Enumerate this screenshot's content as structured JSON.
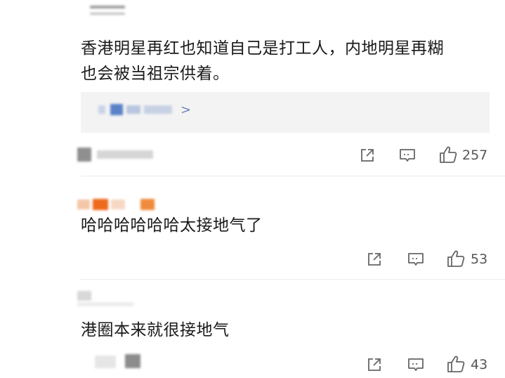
{
  "comments": [
    {
      "text_line1": "香港明星再红也知道自己是打工人，内地明星再糊",
      "text_line2": "也会被当祖宗供着。",
      "likes": "257"
    },
    {
      "text_line1": "哈哈哈哈哈哈太接地气了",
      "likes": "53"
    },
    {
      "text_line1": "港圈本来就很接地气",
      "likes": "43"
    }
  ],
  "quote": {
    "chevron": ">"
  },
  "icons": {
    "share": "share-icon",
    "comment": "comment-icon",
    "like": "thumbs-up-icon"
  },
  "colors": {
    "text": "#1a1a1a",
    "icon": "#666666",
    "quote_bg": "#f3f3f3",
    "link": "#6a86b8"
  }
}
